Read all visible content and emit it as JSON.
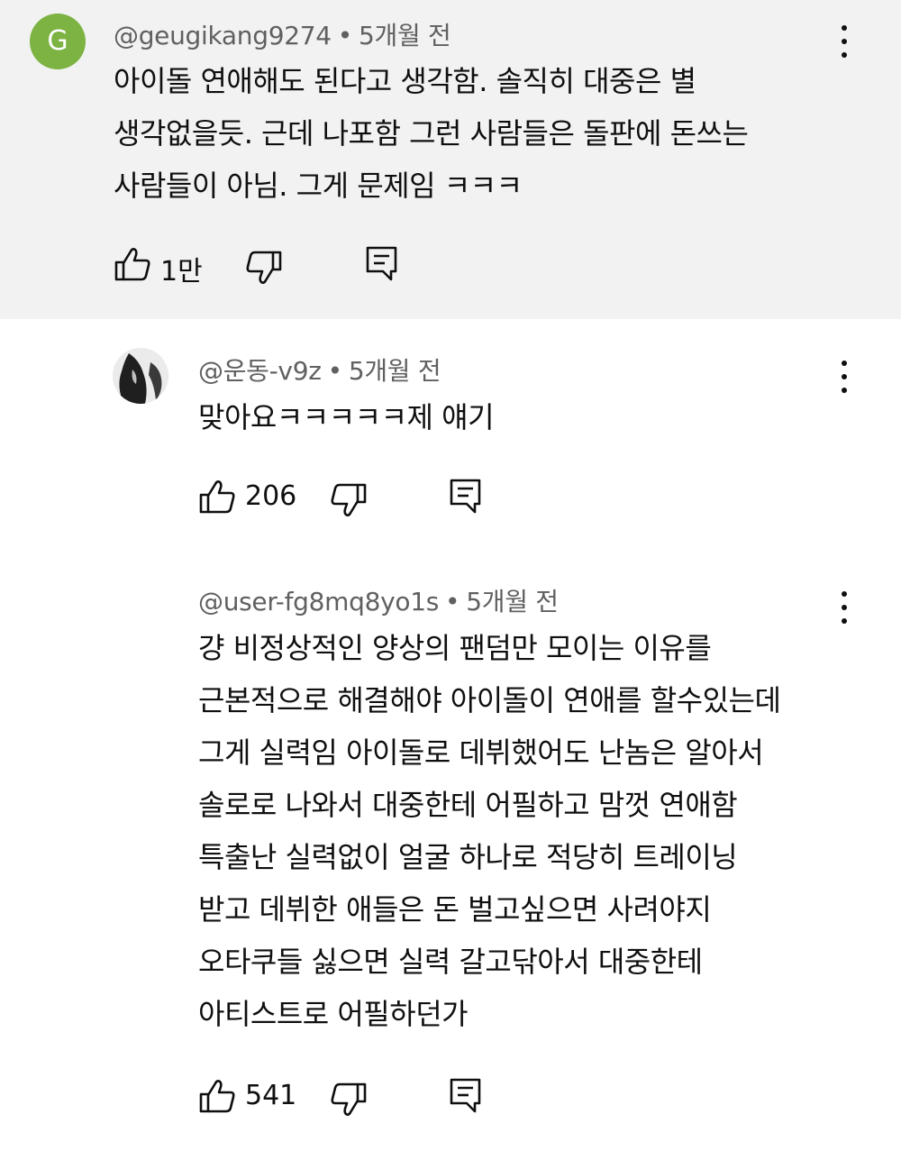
{
  "comments": [
    {
      "handle": "@geugikang9274",
      "separator": "•",
      "time": "5개월 전",
      "avatar_letter": "G",
      "avatar_color": "#7cb342",
      "lines": [
        "아이돌 연애해도 된다고 생각함. 솔직히 대중은 별",
        "생각없을듯. 근데 나포함 그런 사람들은 돌판에 돈쓰는",
        "사람들이 아님. 그게 문제임 ㅋㅋㅋ"
      ],
      "likes": "1만",
      "highlighted": true
    },
    {
      "handle": "@운동-v9z",
      "separator": "•",
      "time": "5개월 전",
      "avatar": "photo",
      "lines": [
        "맞아요ㅋㅋㅋㅋㅋ제 얘기"
      ],
      "likes": "206"
    },
    {
      "handle": "@user-fg8mq8yo1s",
      "separator": "•",
      "time": "5개월 전",
      "avatar": "none",
      "lines": [
        "걍 비정상적인 양상의 팬덤만 모이는 이유를",
        "근본적으로 해결해야 아이돌이 연애를 할수있는데",
        "그게 실력임 아이돌로 데뷔했어도 난놈은 알아서",
        "솔로로 나와서 대중한테 어필하고 맘껏 연애함",
        "특출난 실력없이 얼굴 하나로 적당히 트레이닝",
        "받고 데뷔한 애들은 돈 벌고싶으면 사려야지",
        "오타쿠들 싫으면 실력 갈고닦아서 대중한테",
        "아티스트로 어필하던가"
      ],
      "likes": "541"
    }
  ],
  "icons": {
    "like": "thumbs-up-icon",
    "dislike": "thumbs-down-icon",
    "reply": "reply-comment-icon",
    "more": "more-vertical-icon"
  },
  "colors": {
    "highlight_background": "#f2f2f2",
    "meta_text": "#606060",
    "body_text": "#0f0f0f"
  }
}
